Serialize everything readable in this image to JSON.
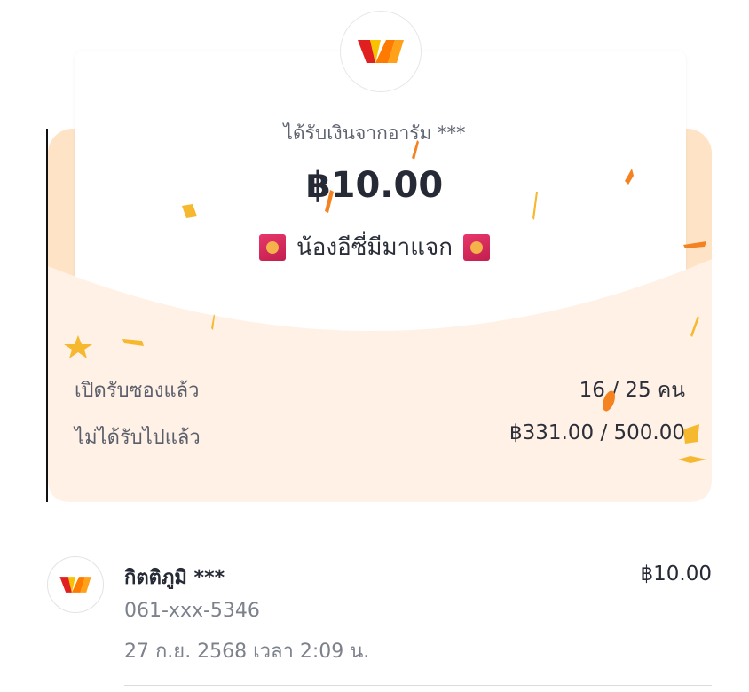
{
  "header": {
    "logo_icon": "true-wallet-logo-icon",
    "received_from": "ได้รับเงินจากอารัม ***",
    "amount": "฿10.00",
    "event_name": "น้องอีซี่มีมาแจก",
    "event_icon": "red-envelope-icon"
  },
  "stats": {
    "opened_label": "เปิดรับซองแล้ว",
    "opened_value": "16 / 25 คน",
    "unclaimed_label": "ไม่ได้รับไปแล้ว",
    "unclaimed_value": "฿331.00 / 500.00"
  },
  "recipients": [
    {
      "name": "กิตติภูมิ ***",
      "amount": "฿10.00",
      "phone": "061-xxx-5346",
      "time": "27 ก.ย. 2568 เวลา 2:09 น."
    }
  ],
  "colors": {
    "envelope_back": "#ffe3c7",
    "envelope_front": "#fff1e6",
    "confetti_orange": "#f58220",
    "confetti_yellow": "#f5b82e"
  }
}
